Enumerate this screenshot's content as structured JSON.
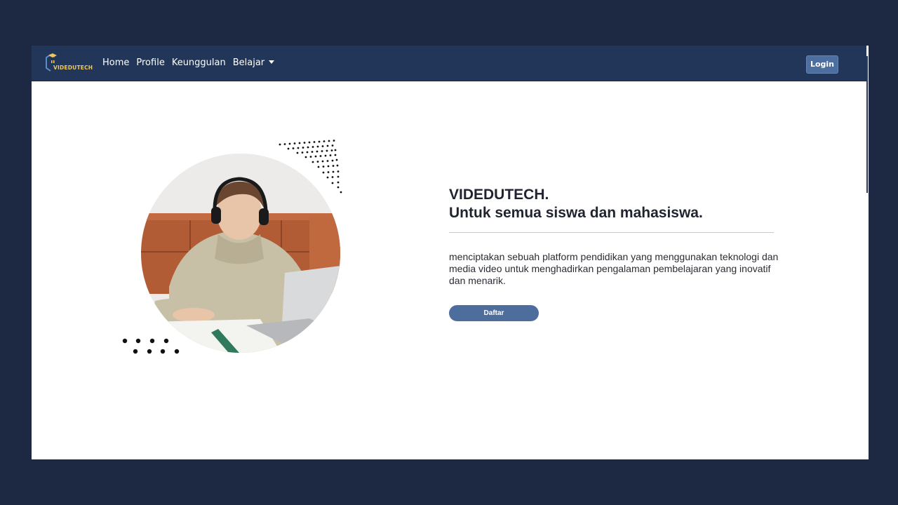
{
  "nav": {
    "logo_text": "VIDEDUTECH",
    "links": [
      "Home",
      "Profile",
      "Keunggulan",
      "Belajar"
    ],
    "login_label": "Login"
  },
  "hero": {
    "title": "VIDEDUTECH.",
    "subtitle": "Untuk semua siswa dan mahasiswa.",
    "description": "menciptakan sebuah platform pendidikan yang menggunakan teknologi dan media video untuk menghadirkan pengalaman pembelajaran yang inovatif dan menarik.",
    "cta_label": "Daftar",
    "image_icon": "student-with-headphones-photo"
  },
  "colors": {
    "background": "#1d2842",
    "navbar": "#213659",
    "button": "#4d6d9c",
    "accent_gold": "#f1c75b"
  }
}
